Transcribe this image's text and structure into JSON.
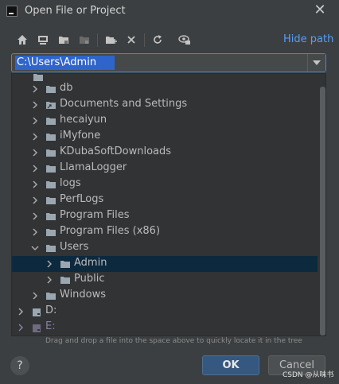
{
  "window": {
    "title": "Open File or Project",
    "close_glyph": "✕"
  },
  "toolbar": {
    "icons": [
      "home-icon",
      "desktop-icon",
      "project-folder-icon",
      "module-folder-icon",
      "new-folder-icon",
      "delete-icon",
      "refresh-icon",
      "show-hidden-icon"
    ],
    "hide_path_label": "Hide path",
    "accent": "#589df6"
  },
  "path": {
    "value": "C:\\Users\\Admin"
  },
  "tree": {
    "items": [
      {
        "label": "db",
        "expanded": false,
        "selected": false
      },
      {
        "label": "Documents and Settings",
        "expanded": false,
        "selected": false,
        "icon": "symlink-folder-icon"
      },
      {
        "label": "hecaiyun",
        "expanded": false,
        "selected": false
      },
      {
        "label": "iMyfone",
        "expanded": false,
        "selected": false
      },
      {
        "label": "KDubaSoftDownloads",
        "expanded": false,
        "selected": false
      },
      {
        "label": "LlamaLogger",
        "expanded": false,
        "selected": false
      },
      {
        "label": "logs",
        "expanded": false,
        "selected": false
      },
      {
        "label": "PerfLogs",
        "expanded": false,
        "selected": false
      },
      {
        "label": "Program Files",
        "expanded": false,
        "selected": false
      },
      {
        "label": "Program Files (x86)",
        "expanded": false,
        "selected": false
      },
      {
        "label": "Users",
        "expanded": true,
        "selected": false
      },
      {
        "label": "Admin",
        "expanded": false,
        "selected": true
      },
      {
        "label": "Public",
        "expanded": false,
        "selected": false
      },
      {
        "label": "Windows",
        "expanded": false,
        "selected": false
      },
      {
        "label": "D:",
        "expanded": false,
        "selected": false,
        "icon": "drive-icon"
      },
      {
        "label": "E:",
        "expanded": false,
        "selected": false,
        "icon": "drive-icon"
      }
    ],
    "selection_color": "#0d293e"
  },
  "hint": "Drag and drop a file into the space above to quickly locate it in the tree",
  "buttons": {
    "help": "?",
    "ok": "OK",
    "cancel": "Cancel"
  },
  "watermark": "CSDN @从味书"
}
